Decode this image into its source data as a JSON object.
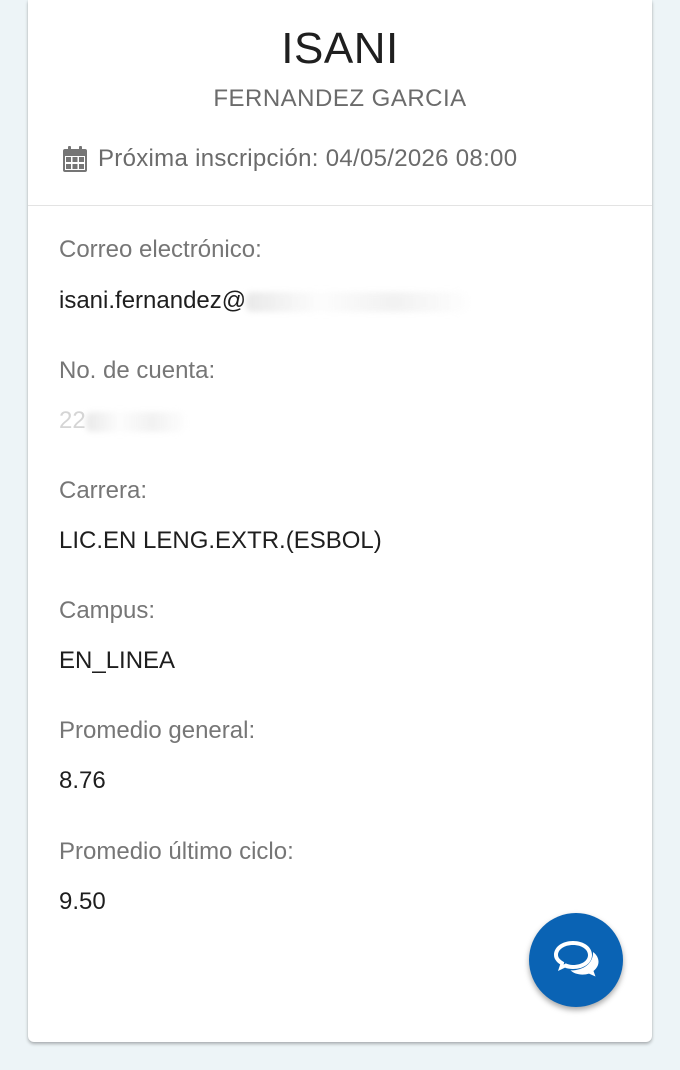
{
  "profile": {
    "first_name": "ISANI",
    "last_name": "FERNANDEZ GARCIA",
    "next_enrollment": "Próxima inscripción: 04/05/2026 08:00"
  },
  "fields": {
    "email": {
      "label": "Correo electrónico:",
      "value": "isani.fernandez@"
    },
    "account": {
      "label": "No. de cuenta:",
      "value": "22"
    },
    "career": {
      "label": "Carrera:",
      "value": "LIC.EN LENG.EXTR.(ESBOL)"
    },
    "campus": {
      "label": "Campus:",
      "value": "EN_LINEA"
    },
    "avg_general": {
      "label": "Promedio general:",
      "value": "8.76"
    },
    "avg_last_cycle": {
      "label": "Promedio último ciclo:",
      "value": "9.50"
    }
  },
  "icons": {
    "calendar": "calendar-icon",
    "chat": "chat-icon"
  },
  "colors": {
    "accent": "#0a63b4",
    "background": "#edf4f7"
  }
}
